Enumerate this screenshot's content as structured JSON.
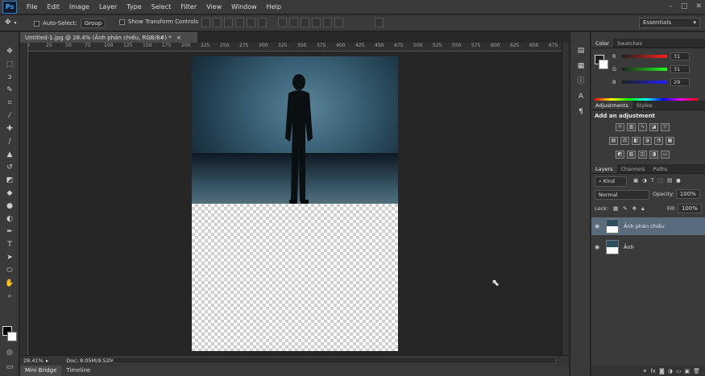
{
  "app": {
    "logo": "Ps"
  },
  "menu": [
    "File",
    "Edit",
    "Image",
    "Layer",
    "Type",
    "Select",
    "Filter",
    "View",
    "Window",
    "Help"
  ],
  "window_controls": [
    "–",
    "□",
    "✕"
  ],
  "options": {
    "auto_select_label": "Auto-Select:",
    "auto_select_value": "Group",
    "transform_label": "Show Transform Controls",
    "workspace": "Essentials"
  },
  "document": {
    "tab_title": "Untitled-1.jpg @ 28.4% (Ảnh phản chiếu, RGB/8#) *",
    "tab_close": "×",
    "zoom": "28.41%",
    "doc_info": "Doc: 8.05M/9.52M"
  },
  "ruler_ticks": [
    "0",
    "25",
    "50",
    "75",
    "100",
    "125",
    "150",
    "175",
    "200",
    "225",
    "250",
    "275",
    "300",
    "325",
    "350",
    "375",
    "400",
    "425",
    "450",
    "475",
    "500",
    "525",
    "550",
    "575",
    "600",
    "625",
    "650",
    "675"
  ],
  "bottom_tabs": [
    "Mini Bridge",
    "Timeline"
  ],
  "color_panel": {
    "tabs": [
      "Color",
      "Swatches"
    ],
    "r_label": "R",
    "g_label": "G",
    "b_label": "B",
    "r": "31",
    "g": "31",
    "b": "29",
    "fg_color": "#1f1f1d"
  },
  "adjustments_panel": {
    "tabs": [
      "Adjustments",
      "Styles"
    ],
    "title": "Add an adjustment"
  },
  "layers_panel": {
    "tabs": [
      "Layers",
      "Channels",
      "Paths"
    ],
    "filter_kind": "Kind",
    "blend_mode": "Normal",
    "opacity_label": "Opacity:",
    "opacity": "100%",
    "lock_label": "Lock:",
    "fill_label": "Fill:",
    "fill": "100%",
    "layers": [
      {
        "name": "Ảnh phản chiếu",
        "selected": true
      },
      {
        "name": "Ảnh",
        "selected": false
      }
    ]
  }
}
